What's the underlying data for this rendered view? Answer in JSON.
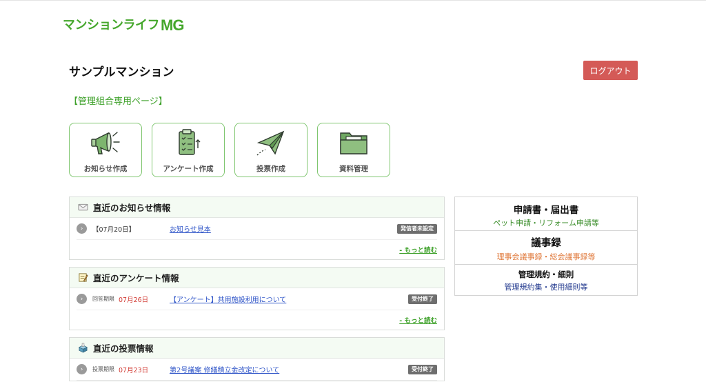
{
  "brand": {
    "name_text": "マンションライフ",
    "name_mark": "MG",
    "color": "#45a72c"
  },
  "header": {
    "building_name": "サンプルマンション",
    "logout_label": "ログアウト",
    "logout_color": "#d45a57"
  },
  "admin_label": "【管理組合専用ページ】",
  "tiles": [
    {
      "label": "お知らせ作成",
      "icon": "megaphone-icon"
    },
    {
      "label": "アンケート作成",
      "icon": "clipboard-checklist-icon"
    },
    {
      "label": "投票作成",
      "icon": "paper-plane-icon"
    },
    {
      "label": "資料管理",
      "icon": "folder-icon"
    }
  ],
  "news": {
    "title": "直近のお知らせ情報",
    "icon": "envelope-icon",
    "items": [
      {
        "date": "【07月20日】",
        "title": "お知らせ見本",
        "badge": "発信者未設定"
      }
    ],
    "more": "- もっと読む"
  },
  "survey": {
    "title": "直近のアンケート情報",
    "icon": "memo-icon",
    "items": [
      {
        "deadline_label": "回答期限",
        "deadline": "07月26日",
        "title": "【アンケート】共用施設利用について",
        "badge": "受付終了"
      }
    ],
    "more": "- もっと読む"
  },
  "vote": {
    "title": "直近の投票情報",
    "icon": "ballot-box-icon",
    "items": [
      {
        "deadline_label": "投票期限",
        "deadline": "07月23日",
        "title": "第2号議案 修繕積立金改定について",
        "badge": "受付終了"
      }
    ]
  },
  "documents": [
    {
      "title": "申請書・届出書",
      "subtitle": "ペット申請・リフォーム申請等",
      "color": "#3e8f2e"
    },
    {
      "title": "議事録",
      "subtitle": "理事会議事録・総会議事録等",
      "color": "#e07a3c"
    },
    {
      "title": "管理規約・細則",
      "subtitle": "管理規約集・使用細則等",
      "color": "#233a8f"
    }
  ]
}
